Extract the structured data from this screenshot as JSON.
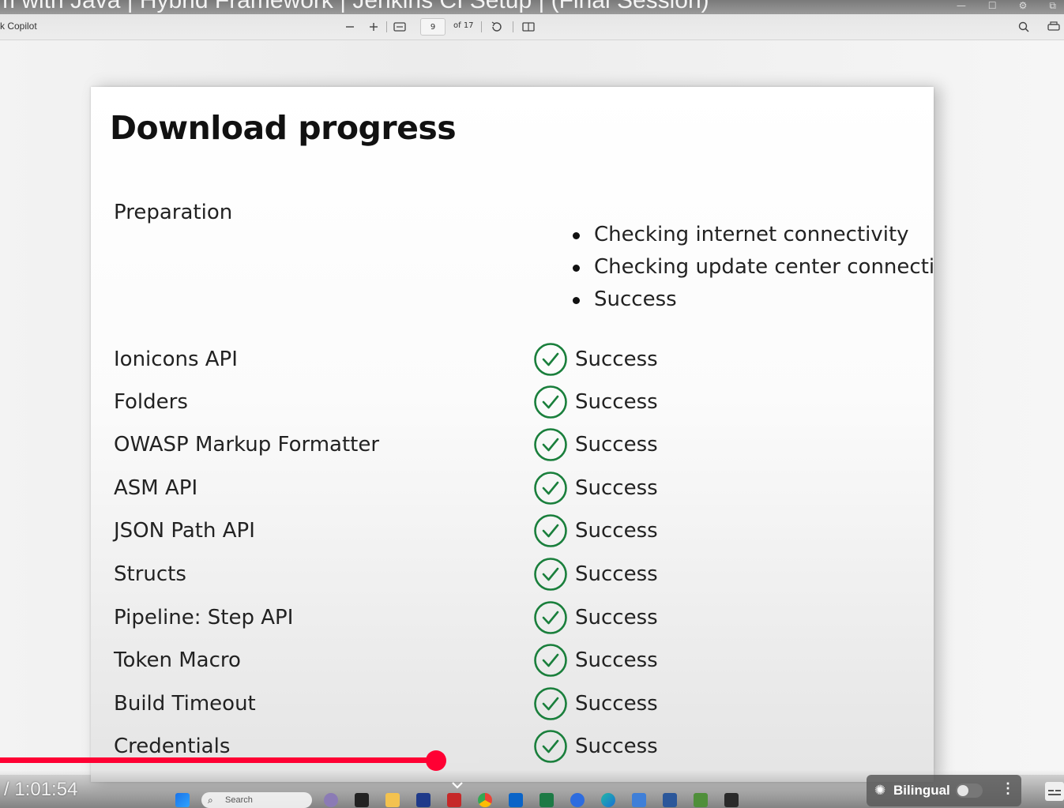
{
  "video": {
    "title_overlay": "m with Java | Hybrid Framework | Jenkins CI Setup | (Final Session)",
    "time": "/ 1:01:54",
    "played_fraction": 0.41,
    "buffered_fraction": 0.45,
    "bilingual_label": "Bilingual",
    "bilingual_on": false,
    "colors": {
      "progress": "#ff0033"
    }
  },
  "pdf_toolbar": {
    "copilot_label": "k Copilot",
    "page_current": "9",
    "page_total": "of 17",
    "icons": [
      "zoom-out-icon",
      "zoom-in-icon",
      "fit-page-icon",
      "rotate-icon",
      "page-view-icon",
      "search-icon",
      "print-icon"
    ]
  },
  "document": {
    "title": "Download progress",
    "preparation": {
      "label": "Preparation",
      "steps": [
        "Checking internet connectivity",
        "Checking update center connectivity",
        "Success"
      ]
    },
    "plugins": [
      {
        "name": "Ionicons API",
        "status": "Success"
      },
      {
        "name": "Folders",
        "status": "Success"
      },
      {
        "name": "OWASP Markup Formatter",
        "status": "Success"
      },
      {
        "name": "ASM API",
        "status": "Success"
      },
      {
        "name": "JSON Path API",
        "status": "Success"
      },
      {
        "name": "Structs",
        "status": "Success"
      },
      {
        "name": "Pipeline: Step API",
        "status": "Success"
      },
      {
        "name": "Token Macro",
        "status": "Success"
      },
      {
        "name": "Build Timeout",
        "status": "Success"
      },
      {
        "name": "Credentials",
        "status": "Success"
      }
    ],
    "colors": {
      "success": "#1a7f3c"
    }
  },
  "taskbar": {
    "search_label": "Search"
  }
}
